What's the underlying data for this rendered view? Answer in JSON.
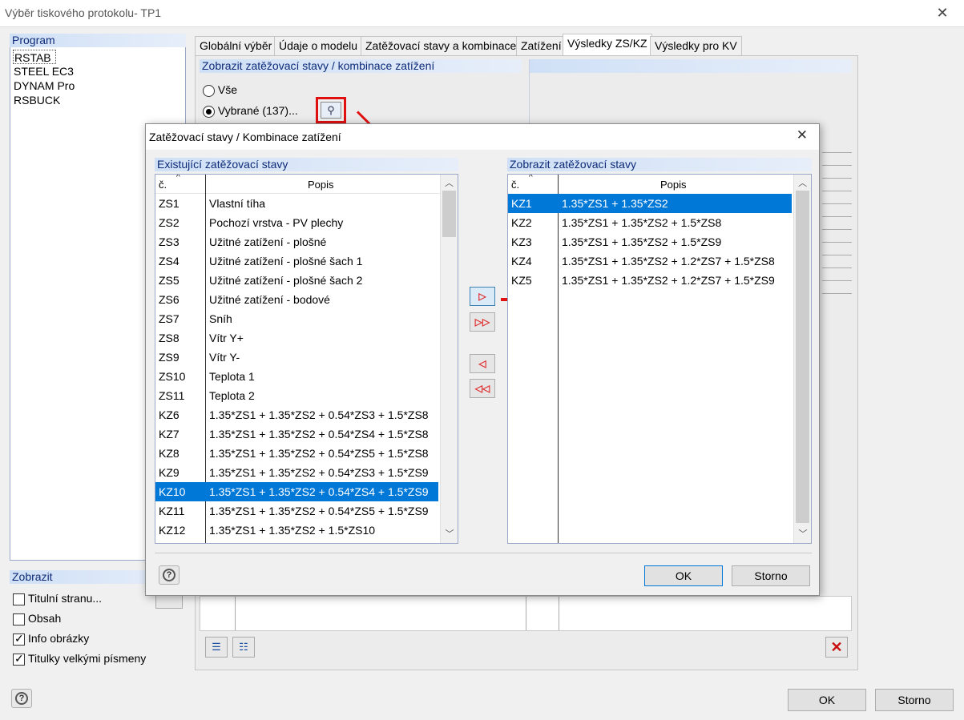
{
  "window": {
    "title": "Výběr tiskového protokolu- TP1",
    "close": "✕"
  },
  "program": {
    "header": "Program",
    "items": [
      "RSTAB",
      "STEEL EC3",
      "DYNAM Pro",
      "RSBUCK"
    ]
  },
  "zobrazit": {
    "header": "Zobrazit",
    "options": [
      {
        "label": "Titulní stranu...",
        "checked": false
      },
      {
        "label": "Obsah",
        "checked": false
      },
      {
        "label": "Info obrázky",
        "checked": true
      },
      {
        "label": "Titulky velkými písmeny",
        "checked": true
      }
    ]
  },
  "tabs": [
    "Globální výběr",
    "Údaje o modelu",
    "Zatěžovací stavy a kombinace",
    "Zatížení",
    "Výsledky ZS/KZ",
    "Výsledky pro KV"
  ],
  "active_tab": "Výsledky ZS/KZ",
  "show_panel": {
    "header": "Zobrazit zatěžovací stavy / kombinace zatížení",
    "radio_all": "Vše",
    "radio_selected": "Vybrané (137)..."
  },
  "dialog": {
    "title": "Zatěžovací stavy / Kombinace zatížení",
    "close": "✕",
    "left_header": "Existující zatěžovací stavy",
    "right_header": "Zobrazit zatěžovací stavy",
    "col_no": "č.",
    "col_desc": "Popis",
    "existing": [
      [
        "ZS1",
        "Vlastní tíha"
      ],
      [
        "ZS2",
        "Pochozí vrstva - PV plechy"
      ],
      [
        "ZS3",
        "Užitné zatížení - plošné"
      ],
      [
        "ZS4",
        "Užitné zatížení - plošné šach 1"
      ],
      [
        "ZS5",
        "Užitné zatížení - plošné šach 2"
      ],
      [
        "ZS6",
        "Užitné zatížení - bodové"
      ],
      [
        "ZS7",
        "Sníh"
      ],
      [
        "ZS8",
        "Vítr Y+"
      ],
      [
        "ZS9",
        "Vítr Y-"
      ],
      [
        "ZS10",
        "Teplota 1"
      ],
      [
        "ZS11",
        "Teplota 2"
      ],
      [
        "KZ6",
        "1.35*ZS1 + 1.35*ZS2 + 0.54*ZS3 + 1.5*ZS8"
      ],
      [
        "KZ7",
        "1.35*ZS1 + 1.35*ZS2 + 0.54*ZS4 + 1.5*ZS8"
      ],
      [
        "KZ8",
        "1.35*ZS1 + 1.35*ZS2 + 0.54*ZS5 + 1.5*ZS8"
      ],
      [
        "KZ9",
        "1.35*ZS1 + 1.35*ZS2 + 0.54*ZS3 + 1.5*ZS9"
      ],
      [
        "KZ10",
        "1.35*ZS1 + 1.35*ZS2 + 0.54*ZS4 + 1.5*ZS9"
      ],
      [
        "KZ11",
        "1.35*ZS1 + 1.35*ZS2 + 0.54*ZS5 + 1.5*ZS9"
      ],
      [
        "KZ12",
        "1.35*ZS1 + 1.35*ZS2 + 1.5*ZS10"
      ]
    ],
    "existing_selected": "KZ10",
    "shown": [
      [
        "KZ1",
        "1.35*ZS1 + 1.35*ZS2"
      ],
      [
        "KZ2",
        "1.35*ZS1 + 1.35*ZS2 + 1.5*ZS8"
      ],
      [
        "KZ3",
        "1.35*ZS1 + 1.35*ZS2 + 1.5*ZS9"
      ],
      [
        "KZ4",
        "1.35*ZS1 + 1.35*ZS2 + 1.2*ZS7 + 1.5*ZS8"
      ],
      [
        "KZ5",
        "1.35*ZS1 + 1.35*ZS2 + 1.2*ZS7 + 1.5*ZS9"
      ]
    ],
    "shown_selected": "KZ1",
    "ok": "OK",
    "cancel": "Storno"
  },
  "footer": {
    "ok": "OK",
    "cancel": "Storno"
  },
  "colors": {
    "accent": "#0078d7",
    "highlight_red": "#e01010",
    "header_text": "#0d2a78"
  }
}
